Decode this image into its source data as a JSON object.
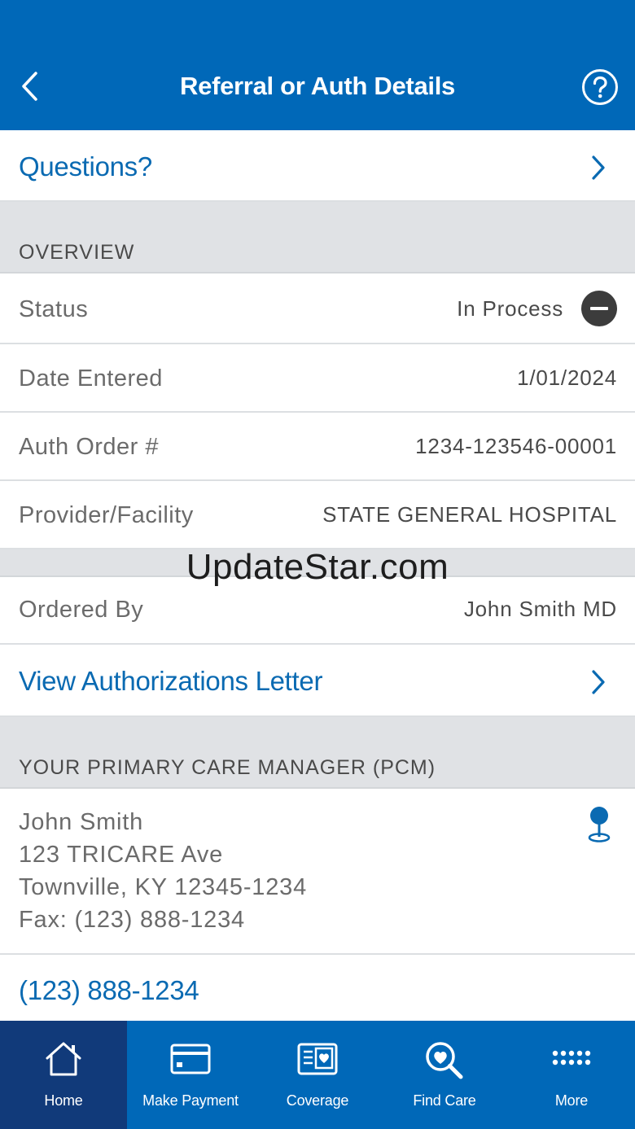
{
  "header": {
    "title": "Referral or Auth Details"
  },
  "questions": {
    "label": "Questions?"
  },
  "overview": {
    "section_label": "OVERVIEW",
    "rows": [
      {
        "label": "Status",
        "value": "In Process"
      },
      {
        "label": "Date Entered",
        "value": "1/01/2024"
      },
      {
        "label": "Auth Order #",
        "value": "1234-123546-00001"
      },
      {
        "label": "Provider/Facility",
        "value": "STATE GENERAL HOSPITAL"
      },
      {
        "label": "Ordered By",
        "value": "John Smith MD"
      }
    ]
  },
  "view_letter": {
    "label": "View Authorizations Letter"
  },
  "pcm": {
    "section_label": "YOUR PRIMARY CARE MANAGER (PCM)",
    "name": "John Smith",
    "address1": "123 TRICARE Ave",
    "address2": "Townville, KY 12345-1234",
    "fax": "Fax: (123) 888-1234",
    "phone": "(123) 888-1234"
  },
  "watermark": "UpdateStar.com",
  "tabs": [
    {
      "label": "Home",
      "icon": "home-icon",
      "active": true
    },
    {
      "label": "Make Payment",
      "icon": "credit-card-icon",
      "active": false
    },
    {
      "label": "Coverage",
      "icon": "coverage-card-icon",
      "active": false
    },
    {
      "label": "Find Care",
      "icon": "search-heart-icon",
      "active": false
    },
    {
      "label": "More",
      "icon": "dots-grid-icon",
      "active": false
    }
  ],
  "colors": {
    "brand_blue": "#0068b8",
    "active_tab": "#113a7a",
    "link_blue": "#0a6ab2",
    "section_gray": "#e0e2e5"
  }
}
